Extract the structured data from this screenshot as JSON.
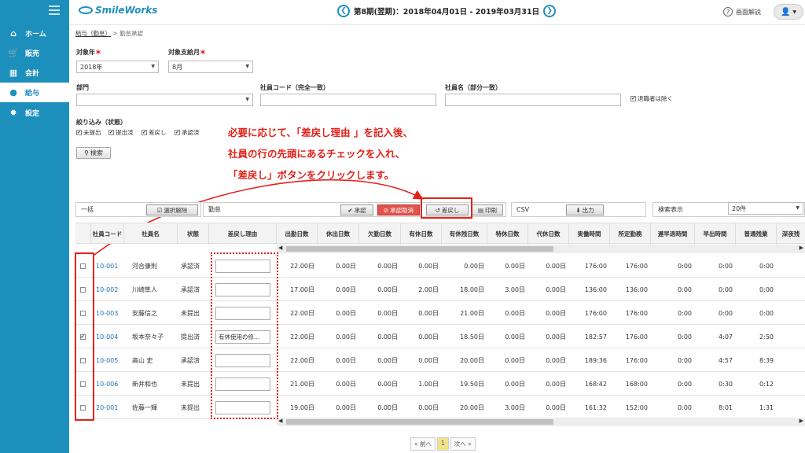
{
  "sidebar": {
    "items": [
      {
        "label": "ホーム",
        "icon": "home-icon"
      },
      {
        "label": "販売",
        "icon": "cart-icon"
      },
      {
        "label": "会計",
        "icon": "calculator-icon"
      },
      {
        "label": "給与",
        "icon": "money-bag-icon",
        "active": true
      },
      {
        "label": "設定",
        "icon": "gear-icon"
      }
    ]
  },
  "header": {
    "logo": "SmileWorks",
    "period": "第8期(翌期)：2018年04月01日 - 2019年03月31日",
    "help": "画面解説"
  },
  "breadcrumb": {
    "parent": "給与（勤怠）",
    "current": "勤怠承認"
  },
  "filters": {
    "year_label": "対象年",
    "year_value": "2018年",
    "month_label": "対象支給月",
    "month_value": "8月",
    "dept_label": "部門",
    "code_label": "社員コード（完全一致）",
    "name_label": "社員名（部分一致）",
    "exclude_retired": "退職者は除く",
    "status_label": "絞り込み（状態）",
    "status_options": [
      "未提出",
      "提出済",
      "差戻し",
      "承認済"
    ],
    "search_button": "検索"
  },
  "annotation": {
    "line1": "必要に応じて、「差戻し理由 」を記入後、",
    "line2": "社員の行の先頭にあるチェックを入れ、",
    "line3": "「差戻し」ボタンをクリックします。"
  },
  "toolbar": {
    "bulk_label": "一括",
    "select_release": "選択解除",
    "attendance_label": "勤怠",
    "approve": "承認",
    "cancel_approve": "承認取消",
    "send_back": "差戻し",
    "print": "印刷",
    "csv_label": "CSV",
    "export": "出力",
    "display_label": "検索表示",
    "display_count": "20件"
  },
  "table": {
    "headers": [
      "社員コード",
      "社員名",
      "状態",
      "差戻し理由",
      "出勤日数",
      "休出日数",
      "欠勤日数",
      "有休日数",
      "有休残日数",
      "特休日数",
      "代休日数",
      "実働時間",
      "所定勤務",
      "遅早退時間",
      "早出時間",
      "普通残業",
      "深夜残"
    ],
    "rows": [
      {
        "checked": false,
        "code": "10-001",
        "name": "河合康則",
        "status": "承認済",
        "reason": "",
        "vals": [
          "22.00日",
          "0.00日",
          "0.00日",
          "0.00日",
          "0.00日",
          "0.00日",
          "0.00日",
          "176:00",
          "176:00",
          "0:00",
          "0:00",
          "0:00"
        ]
      },
      {
        "checked": false,
        "code": "10-002",
        "name": "川崎隼人",
        "status": "承認済",
        "reason": "",
        "vals": [
          "17.00日",
          "0.00日",
          "0.00日",
          "2.00日",
          "18.00日",
          "3.00日",
          "0.00日",
          "136:00",
          "136:00",
          "0:00",
          "0:00",
          "0:00"
        ]
      },
      {
        "checked": false,
        "code": "10-003",
        "name": "安藤信之",
        "status": "未提出",
        "reason": "",
        "vals": [
          "22.00日",
          "0.00日",
          "0.00日",
          "0.00日",
          "21.00日",
          "0.00日",
          "0.00日",
          "176:00",
          "176:00",
          "0:00",
          "0:00",
          "0:00"
        ]
      },
      {
        "checked": true,
        "code": "10-004",
        "name": "坂本奈々子",
        "status": "提出済",
        "reason": "有休使用の修…",
        "vals": [
          "22.00日",
          "0.00日",
          "0.00日",
          "0.00日",
          "18.50日",
          "0.00日",
          "0.00日",
          "182:57",
          "176:00",
          "0:00",
          "4:07",
          "2:50"
        ]
      },
      {
        "checked": false,
        "code": "10-005",
        "name": "高山 史",
        "status": "承認済",
        "reason": "",
        "vals": [
          "22.00日",
          "0.00日",
          "0.00日",
          "0.00日",
          "20.00日",
          "0.00日",
          "0.00日",
          "189:36",
          "176:00",
          "0:00",
          "4:57",
          "8:39"
        ]
      },
      {
        "checked": false,
        "code": "10-006",
        "name": "新井和也",
        "status": "未提出",
        "reason": "",
        "vals": [
          "21.00日",
          "0.00日",
          "0.00日",
          "1.00日",
          "19.50日",
          "0.00日",
          "0.00日",
          "168:42",
          "168:00",
          "0:00",
          "0:30",
          "0:12"
        ]
      },
      {
        "checked": false,
        "code": "20-001",
        "name": "佐藤一輝",
        "status": "未提出",
        "reason": "",
        "vals": [
          "19.00日",
          "0.00日",
          "0.00日",
          "0.00日",
          "20.00日",
          "3.00日",
          "0.00日",
          "161:32",
          "152:00",
          "0:00",
          "8:01",
          "1:31"
        ]
      }
    ]
  },
  "pager": {
    "prev": "« 前へ",
    "page": "1",
    "next": "次へ »"
  }
}
